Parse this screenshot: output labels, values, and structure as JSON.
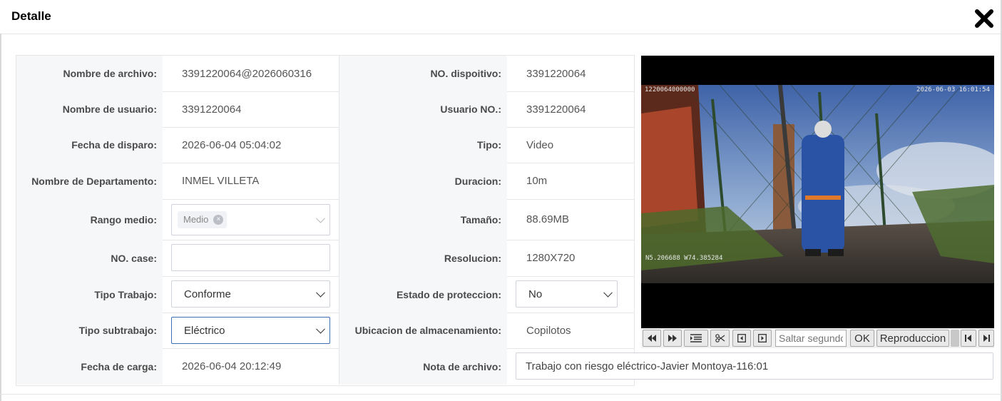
{
  "dialog": {
    "title": "Detalle",
    "close_icon": "close-x-icon"
  },
  "fields": {
    "nombre_archivo": {
      "label": "Nombre de archivo:",
      "value": "3391220064@2026060316"
    },
    "nombre_usuario": {
      "label": "Nombre de usuario:",
      "value": "3391220064"
    },
    "fecha_disparo": {
      "label": "Fecha de disparo:",
      "value": "2026-06-04 05:04:02"
    },
    "departamento": {
      "label": "Nombre de Departamento:",
      "value": "INMEL VILLETA"
    },
    "rango_medio": {
      "label": "Rango medio:",
      "tag": "Medio",
      "tag_remove": "×"
    },
    "no_case": {
      "label": "NO. case:",
      "value": ""
    },
    "tipo_trabajo": {
      "label": "Tipo Trabajo:",
      "value": "Conforme"
    },
    "tipo_subtrabajo": {
      "label": "Tipo subtrabajo:",
      "value": "Eléctrico"
    },
    "fecha_carga": {
      "label": "Fecha de carga:",
      "value": "2026-06-04 20:12:49"
    },
    "no_dispositivo": {
      "label": "NO. dispoitivo:",
      "value": "3391220064"
    },
    "usuario_no": {
      "label": "Usuario NO.:",
      "value": "3391220064"
    },
    "tipo": {
      "label": "Tipo:",
      "value": "Video"
    },
    "duracion": {
      "label": "Duracion:",
      "value": "10m"
    },
    "tamano": {
      "label": "Tamaño:",
      "value": "88.69MB"
    },
    "resolucion": {
      "label": "Resolucion:",
      "value": "1280X720"
    },
    "estado_proteccion": {
      "label": "Estado de proteccion:",
      "value": "No"
    },
    "ubicacion": {
      "label": "Ubicacion de almacenamiento:",
      "value": "Copilotos"
    },
    "nota_archivo": {
      "label": "Nota de archivo:",
      "value": "Trabajo con riesgo eléctrico-Javier Montoya-116:01"
    }
  },
  "video": {
    "osd_top_left": "1220064000000",
    "osd_top_right": "2026-06-03 16:01:54",
    "osd_bottom_left": "N5.206688 W74.385284"
  },
  "player_controls": {
    "rewind_icon": "rewind-icon",
    "fast_forward_icon": "fast-forward-icon",
    "playlist_icon": "list-icon",
    "clip_icon": "scissors-icon",
    "prev_frame_icon": "prev-frame-icon",
    "next_frame_icon": "next-frame-icon",
    "seek_placeholder": "Saltar segundos",
    "ok_label": "OK",
    "playback_label": "Reproduccion",
    "skip_start_icon": "skip-start-icon",
    "skip_end_icon": "skip-end-icon"
  }
}
